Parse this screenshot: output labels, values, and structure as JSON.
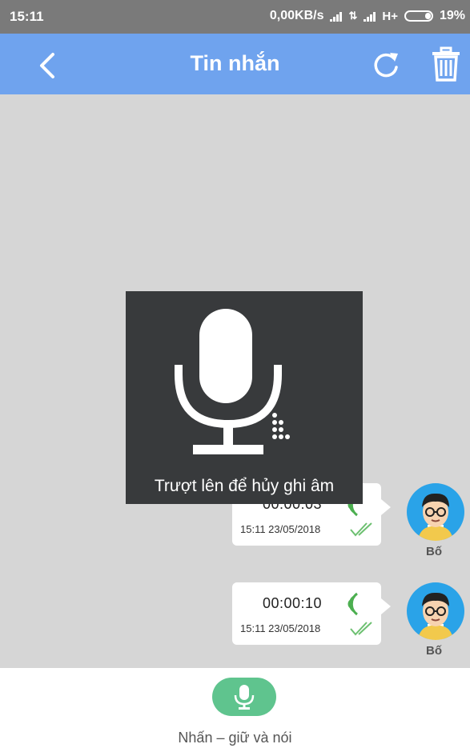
{
  "status_bar": {
    "time": "15:11",
    "network_speed": "0,00KB/s",
    "network_type": "H+",
    "battery": "19%"
  },
  "header": {
    "title": "Tin nhắn",
    "back_icon": "chevron-left-icon",
    "refresh_icon": "refresh-icon",
    "delete_icon": "trash-icon",
    "background_color": "#6fa3ee"
  },
  "messages": [
    {
      "duration": "00:00:03",
      "timestamp": "15:11 23/05/2018",
      "sender": "Bố"
    },
    {
      "duration": "00:00:10",
      "timestamp": "15:11 23/05/2018",
      "sender": "Bố"
    }
  ],
  "recording_overlay": {
    "hint": "Trượt lên để hủy ghi âm",
    "icon": "microphone-icon"
  },
  "bottom_bar": {
    "hint": "Nhấn – giữ và nói",
    "button_color": "#5fc48e",
    "icon": "microphone-icon"
  },
  "colors": {
    "chat_background": "#d6d6d6",
    "wave_green": "#4caf50",
    "avatar_blue": "#2aa3e8"
  }
}
